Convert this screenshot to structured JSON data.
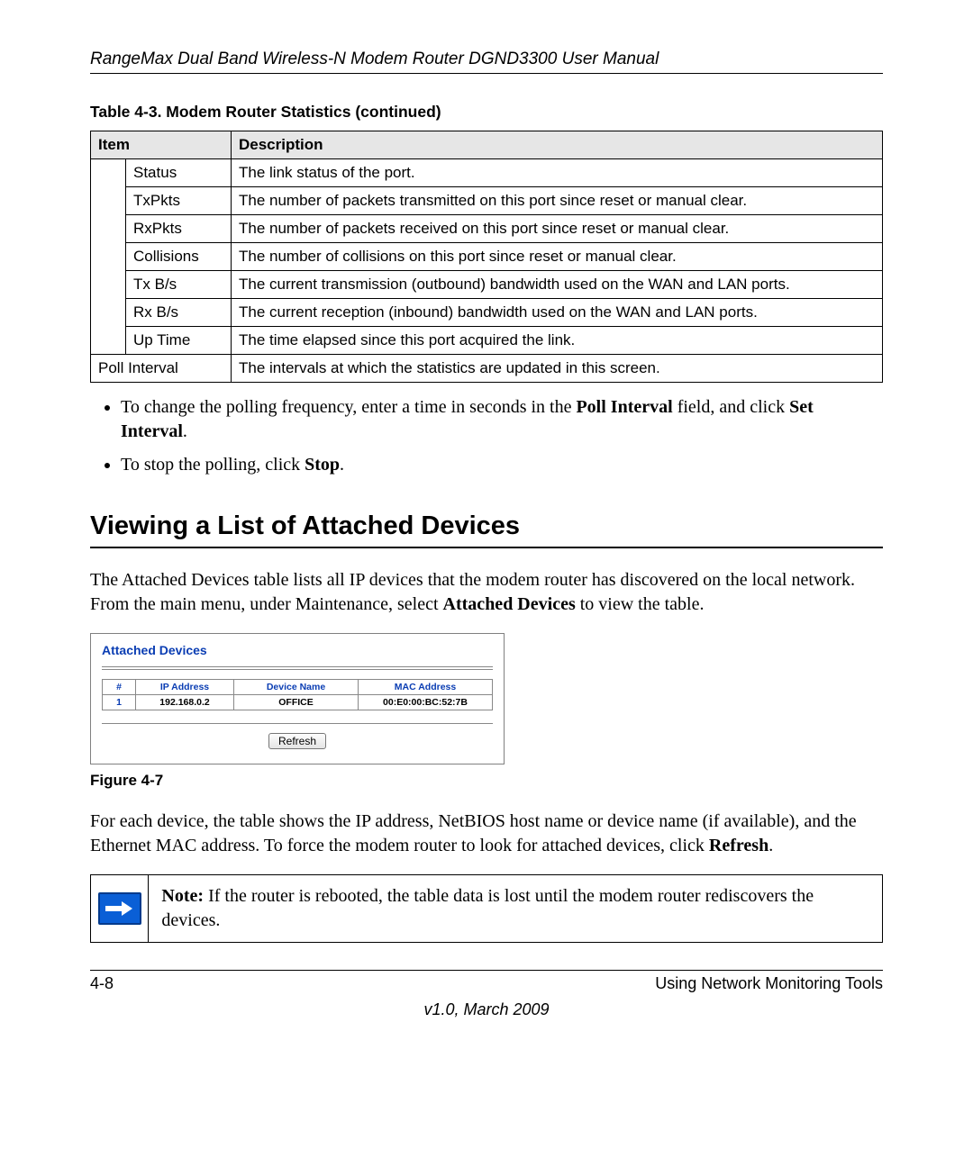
{
  "header": {
    "running": "RangeMax Dual Band Wireless-N Modem Router DGND3300 User Manual"
  },
  "table_caption": "Table 4-3.  Modem Router Statistics  (continued)",
  "table": {
    "head_item": "Item",
    "head_desc": "Description",
    "rows": [
      {
        "item": "Status",
        "desc": "The link status of the port."
      },
      {
        "item": "TxPkts",
        "desc": "The number of packets transmitted on this port since reset or manual clear."
      },
      {
        "item": "RxPkts",
        "desc": "The number of packets received on this port since reset or manual clear."
      },
      {
        "item": "Collisions",
        "desc": "The number of collisions on this port since reset or manual clear."
      },
      {
        "item": "Tx B/s",
        "desc": "The current transmission (outbound) bandwidth used on the WAN and LAN ports."
      },
      {
        "item": "Rx B/s",
        "desc": "The current reception (inbound) bandwidth used on the WAN and LAN ports."
      },
      {
        "item": "Up Time",
        "desc": "The time elapsed since this port acquired the link."
      }
    ],
    "poll_item": "Poll Interval",
    "poll_desc": "The intervals at which the statistics are updated in this screen."
  },
  "bullets": {
    "b1_a": "To change the polling frequency, enter a time in seconds in the ",
    "b1_b": "Poll Interval",
    "b1_c": " field, and click ",
    "b1_d": "Set Interval",
    "b1_e": ".",
    "b2_a": "To stop the polling, click ",
    "b2_b": "Stop",
    "b2_c": "."
  },
  "section_heading": "Viewing a List of Attached Devices",
  "para1_a": "The Attached Devices table lists all IP devices that the modem router has discovered on the local network. From the main menu, under Maintenance, select ",
  "para1_b": "Attached Devices",
  "para1_c": " to view the table.",
  "figure": {
    "title": "Attached Devices",
    "headers": {
      "num": "#",
      "ip": "IP Address",
      "name": "Device Name",
      "mac": "MAC Address"
    },
    "row": {
      "num": "1",
      "ip": "192.168.0.2",
      "name": "OFFICE",
      "mac": "00:E0:00:BC:52:7B"
    },
    "refresh": "Refresh",
    "caption": "Figure 4-7"
  },
  "para2_a": "For each device, the table shows the IP address, NetBIOS host name or device name (if available), and the Ethernet MAC address. To force the modem router to look for attached devices, click ",
  "para2_b": "Refresh",
  "para2_c": ".",
  "note": {
    "label": "Note:",
    "text": " If the router is rebooted, the table data is lost until the modem router rediscovers the devices."
  },
  "footer": {
    "left": "4-8",
    "right": "Using Network Monitoring Tools",
    "center": "v1.0, March 2009"
  }
}
